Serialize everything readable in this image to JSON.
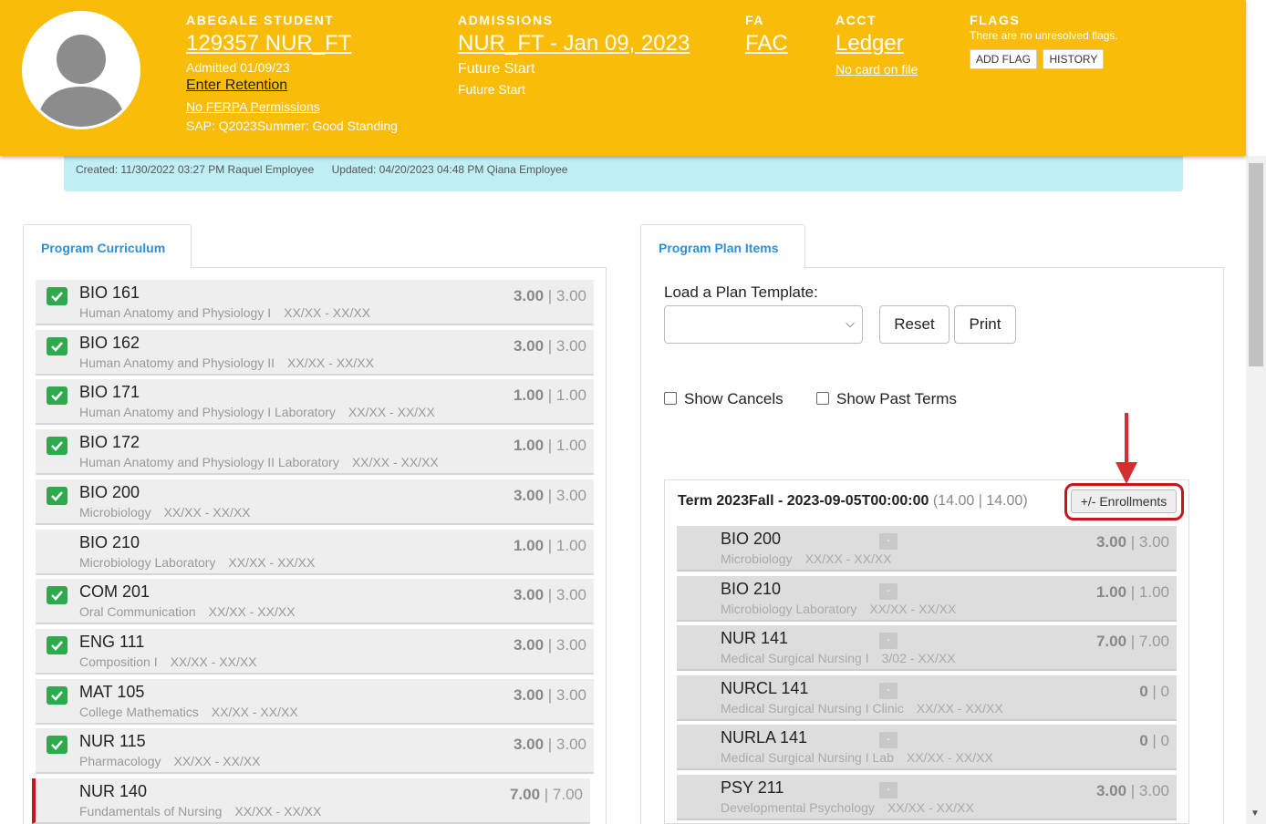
{
  "header": {
    "student": {
      "label": "ABEGALE STUDENT",
      "id_program": "129357 NUR_FT",
      "admitted": "Admitted 01/09/23",
      "retention_link": "Enter Retention",
      "ferpa_link": "No FERPA Permissions",
      "sap": "SAP: Q2023Summer: Good Standing"
    },
    "admissions": {
      "label": "ADMISSIONS",
      "program_date": "NUR_FT - Jan 09, 2023",
      "status1": "Future Start",
      "status2": "Future Start"
    },
    "fa": {
      "label": "FA",
      "value": "FAC"
    },
    "acct": {
      "label": "ACCT",
      "value": "Ledger",
      "card": "No card on file"
    },
    "flags": {
      "label": "FLAGS",
      "note": "There are no unresolved flags.",
      "add_flag": "ADD FLAG",
      "history": "HISTORY"
    }
  },
  "infobar": {
    "created": "Created: 11/30/2022 03:27 PM Raquel Employee",
    "updated": "Updated: 04/20/2023 04:48 PM Qiana Employee"
  },
  "left_tab": "Program Curriculum",
  "right_tab": "Program Plan Items",
  "curriculum": [
    {
      "code": "BIO 161",
      "name": "Human Anatomy and Physiology I",
      "dates": "XX/XX - XX/XX",
      "earned": "3.00",
      "total": "3.00",
      "checked": true
    },
    {
      "code": "BIO 162",
      "name": "Human Anatomy and Physiology II",
      "dates": "XX/XX - XX/XX",
      "earned": "3.00",
      "total": "3.00",
      "checked": true
    },
    {
      "code": "BIO 171",
      "name": "Human Anatomy and Physiology I Laboratory",
      "dates": "XX/XX - XX/XX",
      "earned": "1.00",
      "total": "1.00",
      "checked": true
    },
    {
      "code": "BIO 172",
      "name": "Human Anatomy and Physiology II Laboratory",
      "dates": "XX/XX - XX/XX",
      "earned": "1.00",
      "total": "1.00",
      "checked": true
    },
    {
      "code": "BIO 200",
      "name": "Microbiology",
      "dates": "XX/XX - XX/XX",
      "earned": "3.00",
      "total": "3.00",
      "checked": true
    },
    {
      "code": "BIO 210",
      "name": "Microbiology Laboratory",
      "dates": "XX/XX - XX/XX",
      "earned": "1.00",
      "total": "1.00",
      "checked": false
    },
    {
      "code": "COM 201",
      "name": "Oral Communication",
      "dates": "XX/XX - XX/XX",
      "earned": "3.00",
      "total": "3.00",
      "checked": true
    },
    {
      "code": "ENG 111",
      "name": "Composition I",
      "dates": "XX/XX - XX/XX",
      "earned": "3.00",
      "total": "3.00",
      "checked": true
    },
    {
      "code": "MAT 105",
      "name": "College Mathematics",
      "dates": "XX/XX - XX/XX",
      "earned": "3.00",
      "total": "3.00",
      "checked": true
    },
    {
      "code": "NUR 115",
      "name": "Pharmacology",
      "dates": "XX/XX - XX/XX",
      "earned": "3.00",
      "total": "3.00",
      "checked": true
    },
    {
      "code": "NUR 140",
      "name": "Fundamentals of Nursing",
      "dates": "XX/XX - XX/XX",
      "earned": "7.00",
      "total": "7.00",
      "checked": false
    }
  ],
  "plan": {
    "template_label": "Load a Plan Template:",
    "reset": "Reset",
    "print": "Print",
    "show_cancels": "Show Cancels",
    "show_past_terms": "Show Past Terms",
    "term_title": "Term 2023Fall - 2023-09-05T00:00:00",
    "term_total": "(14.00 | 14.00)",
    "enrollments_button": "+/- Enrollments",
    "items": [
      {
        "code": "BIO 200",
        "name": "Microbiology",
        "dates": "XX/XX - XX/XX",
        "earned": "3.00",
        "total": "3.00"
      },
      {
        "code": "BIO 210",
        "name": "Microbiology Laboratory",
        "dates": "XX/XX - XX/XX",
        "earned": "1.00",
        "total": "1.00"
      },
      {
        "code": "NUR 141",
        "name": "Medical Surgical Nursing I",
        "dates": "3/02 - XX/XX",
        "earned": "7.00",
        "total": "7.00"
      },
      {
        "code": "NURCL 141",
        "name": "Medical Surgical Nursing I Clinic",
        "dates": "XX/XX - XX/XX",
        "earned": "0",
        "total": "0"
      },
      {
        "code": "NURLA 141",
        "name": "Medical Surgical Nursing I Lab",
        "dates": "XX/XX - XX/XX",
        "earned": "0",
        "total": "0"
      },
      {
        "code": "PSY 211",
        "name": "Developmental Psychology",
        "dates": "XX/XX - XX/XX",
        "earned": "3.00",
        "total": "3.00"
      }
    ]
  },
  "colors": {
    "header_bg": "#f9bc08",
    "info_bg": "#bfeef5",
    "check_green": "#2eaa4e",
    "alert_red": "#c9141e",
    "tab_blue": "#2d8fd5"
  }
}
